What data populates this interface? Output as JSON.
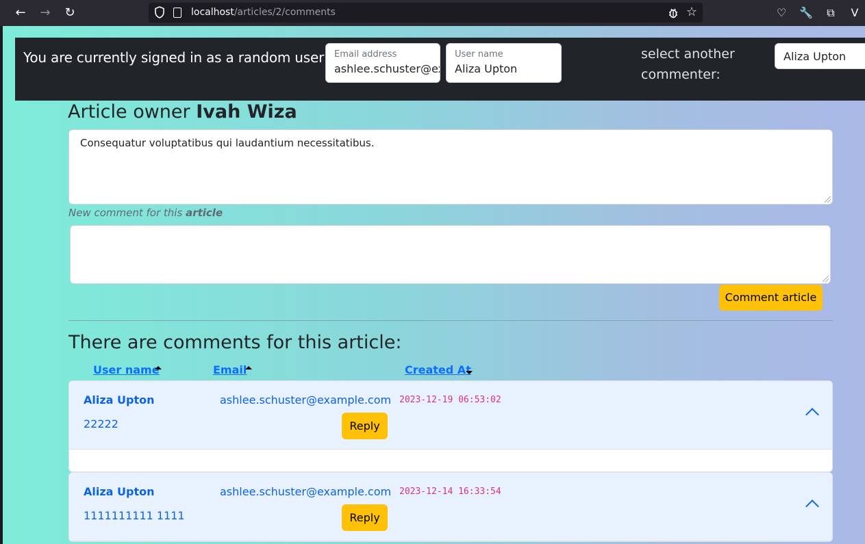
{
  "browser": {
    "url_host": "localhost",
    "url_path": "/articles/2/comments"
  },
  "topbar": {
    "signed_in_text": "You are currently signed in as a random user:",
    "email_label": "Email address",
    "email_value": "ashlee.schuster@example.com",
    "username_label": "User name",
    "username_value": "Aliza Upton",
    "select_label": "select another commenter:",
    "select_value": "Aliza Upton"
  },
  "article": {
    "owner_prefix": "Article owner",
    "owner_name": "Ivah Wiza",
    "body": "Consequatur voluptatibus qui laudantium necessitatibus."
  },
  "new_comment": {
    "label_prefix": "New comment for this",
    "label_bold": "article",
    "value": "",
    "submit_label": "Comment article"
  },
  "comments": {
    "title": "There are comments for this article:",
    "columns": [
      {
        "label": "User name",
        "sort": "asc"
      },
      {
        "label": "Email",
        "sort": "asc"
      },
      {
        "label": "Created At",
        "sort": "desc"
      }
    ],
    "items": [
      {
        "user": "Aliza Upton",
        "email": "ashlee.schuster@example.com",
        "created_at": "2023-12-19 06:53:02",
        "body": "22222",
        "reply_label": "Reply"
      },
      {
        "user": "Aliza Upton",
        "email": "ashlee.schuster@example.com",
        "created_at": "2023-12-14 16:33:54",
        "body": "1111111111 1111",
        "reply_label": "Reply"
      }
    ]
  }
}
